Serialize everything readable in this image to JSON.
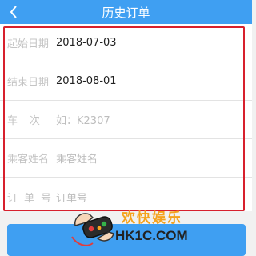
{
  "header": {
    "title": "历史订单",
    "back_icon": "chevron-left-icon"
  },
  "form": {
    "fields": [
      {
        "label": "起始日期",
        "value": "2018-07-03",
        "placeholder": ""
      },
      {
        "label": "结束日期",
        "value": "2018-08-01",
        "placeholder": ""
      },
      {
        "label": "车次",
        "value": "",
        "placeholder": "如：K2307"
      },
      {
        "label": "乘客姓名",
        "value": "",
        "placeholder": "乘客姓名"
      },
      {
        "label": "订单号",
        "value": "",
        "placeholder": "订单号"
      }
    ]
  },
  "watermark": {
    "cn": "欢快娱乐",
    "en": "HK1C.COM"
  },
  "colors": {
    "accent": "#3f9ff2",
    "highlight": "#d7202d"
  }
}
